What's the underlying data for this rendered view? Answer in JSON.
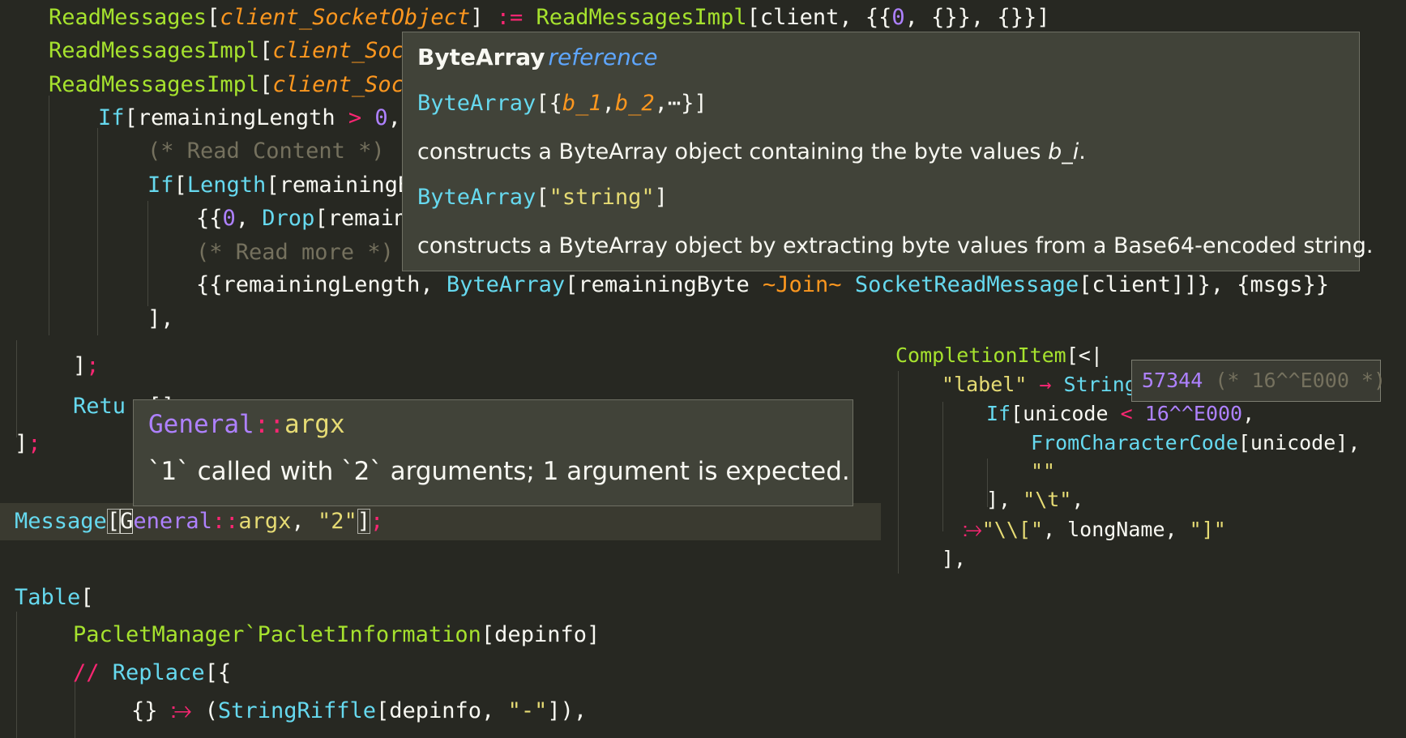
{
  "editor": {
    "l1": {
      "a": "ReadMessages",
      "b": "[",
      "c": "client_SocketObject",
      "d": "] ",
      "e": ":=",
      "f": " ReadMessagesImpl",
      "g": "[client, {{",
      "h": "0",
      "i": ", {}}, {}}]"
    },
    "l2": {
      "a": "ReadMessagesImpl",
      "b": "[",
      "c": "client_Socke"
    },
    "l3": {
      "a": "ReadMessagesImpl",
      "b": "[",
      "c": "client_Socke"
    },
    "l4": {
      "a": "If",
      "b": "[remainingLength ",
      "c": ">",
      "d": " ",
      "e": "0",
      "f": ","
    },
    "l5": {
      "a": "(* Read Content *)"
    },
    "l6": {
      "a": "If",
      "b": "[",
      "c": "Length",
      "d": "[remainingBy"
    },
    "l7": {
      "a": "{{",
      "b": "0",
      "c": ", ",
      "d": "Drop",
      "e": "[remaini"
    },
    "l8": {
      "a": "(* Read more *)"
    },
    "l9": {
      "a": "{{remainingLength, ",
      "b": "ByteArray",
      "c": "[remainingByte ",
      "d": "~Join~",
      "e": " ",
      "f": "SocketReadMessage",
      "g": "[client]]}, {msgs}}"
    },
    "l10": {
      "a": "],"
    },
    "l11": {
      "a": "]",
      "b": ";"
    },
    "l12": {
      "a": "Retu",
      "b": "[]"
    },
    "l13": {
      "a": "]",
      "b": ";"
    },
    "l14": {
      "a": "Message",
      "b": "[",
      "c": "G",
      "d": "eneral",
      "e": "::",
      "f": "argx",
      "g": ", ",
      "h": "\"2\"",
      "i": "]",
      "j": ";"
    },
    "l15": {
      "a": "Table",
      "b": "["
    },
    "l16": {
      "a": "PacletManager`PacletInformation",
      "b": "[depinfo]"
    },
    "l17": {
      "a": "//",
      "b": " ",
      "c": "Replace",
      "d": "[{"
    },
    "l18": {
      "a": "{} ",
      "b": "⧴",
      "c": " (",
      "d": "StringRiffle",
      "e": "[depinfo, ",
      "f": "\"-\"",
      "g": "]),"
    }
  },
  "right_code": {
    "r1": {
      "a": "CompletionItem",
      "b": "[<|"
    },
    "r2": {
      "a": "\"label\"",
      "b": " → ",
      "c": "String"
    },
    "r3": {
      "a": "If",
      "b": "[unicode ",
      "c": "<",
      "d": " ",
      "e": "16^^E000",
      "f": ","
    },
    "r4": {
      "a": "FromCharacterCode",
      "b": "[unicode],"
    },
    "r5": {
      "a": "\"\""
    },
    "r6": {
      "a": "], ",
      "b": "\"\\t\"",
      "c": ","
    },
    "r7": {
      "a": "⧴",
      "b": "\"\\\\[\"",
      "c": ", longName, ",
      "d": "\"]\""
    },
    "r8": {
      "a": "],"
    }
  },
  "inlay_hint": {
    "value": "57344",
    "comment": " (* 16^^E000 *)"
  },
  "hover_popup": {
    "title": "ByteArray",
    "kind": "reference",
    "usage1": {
      "sym": "ByteArray",
      "b1": "[{",
      "a1": "b_1",
      "c1": ",",
      "a2": "b_2",
      "c2": ",⋯}]"
    },
    "desc1_pre": "constructs a ByteArray object containing the byte values ",
    "desc1_var": "b_i",
    "desc1_post": ".",
    "usage2": {
      "sym": "ByteArray",
      "b1": "[",
      "str": "\"string\"",
      "b2": "]"
    },
    "desc2": "constructs a ByteArray object by extracting byte values from a Base64-encoded string."
  },
  "diagnostic_popup": {
    "sym": "General",
    "sep": "::",
    "tag": "argx",
    "message": "`1` called with `2` arguments; 1 argument is expected."
  }
}
